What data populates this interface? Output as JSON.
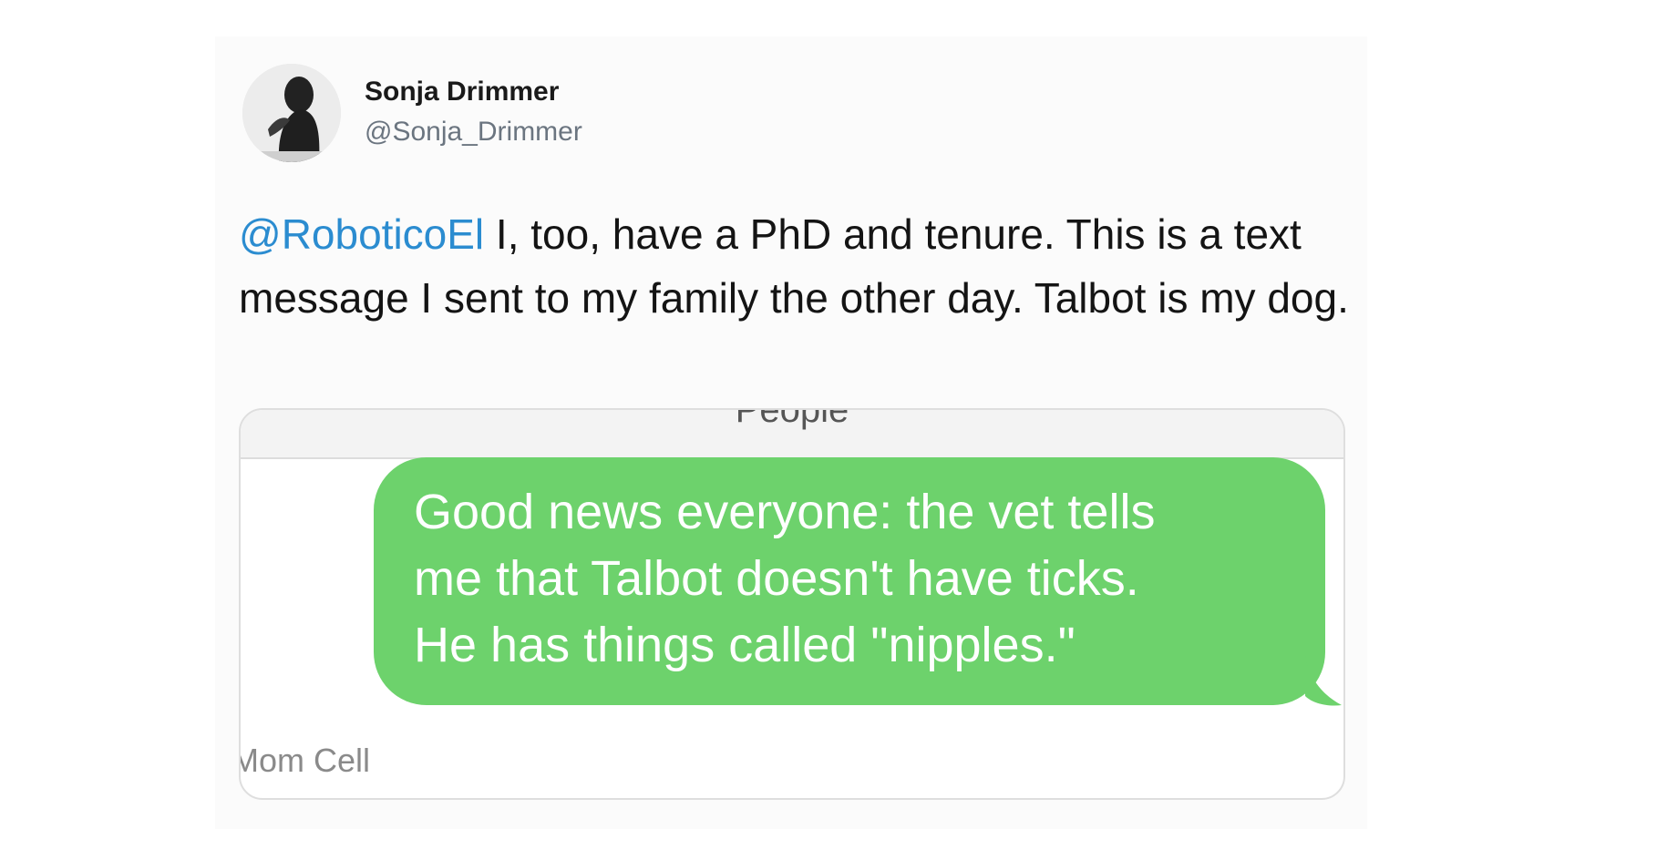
{
  "tweet": {
    "author_name": "Sonja Drimmer",
    "author_handle": "@Sonja_Drimmer",
    "mention": "@RoboticoEl",
    "body": " I, too, have a PhD and tenure. This is a text message I sent to my family the other day. Talbot is my dog."
  },
  "message_screenshot": {
    "header_label": "People",
    "bubble_lines": [
      "Good news everyone: the vet tells",
      "me that Talbot doesn't have ticks.",
      "He has things called \"nipples.\""
    ],
    "footer_label": "Mom Cell",
    "bubble_color": "#6dd26c"
  },
  "colors": {
    "mention": "#2b8cd0",
    "handle": "#6b7580"
  }
}
